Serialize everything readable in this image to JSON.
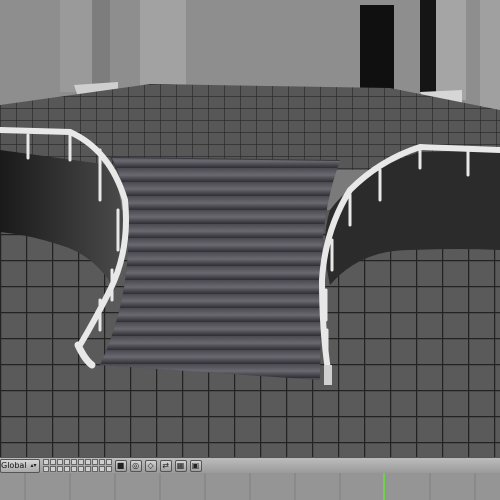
{
  "window": {
    "type": "3d-viewport"
  },
  "viewport": {
    "scene": "grand double staircase with curved railings and tiled floor",
    "colors": {
      "floor_tile": "#5a5a5a",
      "grid_line": "#232323",
      "wall": "#8d8d8d",
      "stairs": "#5e5c64",
      "railing": "#e6e6e6"
    }
  },
  "header": {
    "orientation_value": "Global",
    "buttons": [
      {
        "name": "lock-icon",
        "glyph": "■"
      },
      {
        "name": "pivot-icon",
        "glyph": "◎"
      },
      {
        "name": "snap-icon",
        "glyph": "◇"
      },
      {
        "name": "manipulator-icon",
        "glyph": "⇄"
      },
      {
        "name": "render-icon",
        "glyph": "▦"
      },
      {
        "name": "camera-icon",
        "glyph": "▣"
      }
    ]
  },
  "timeline": {
    "current_frame_color": "#6fd14a",
    "background": "#959595"
  }
}
